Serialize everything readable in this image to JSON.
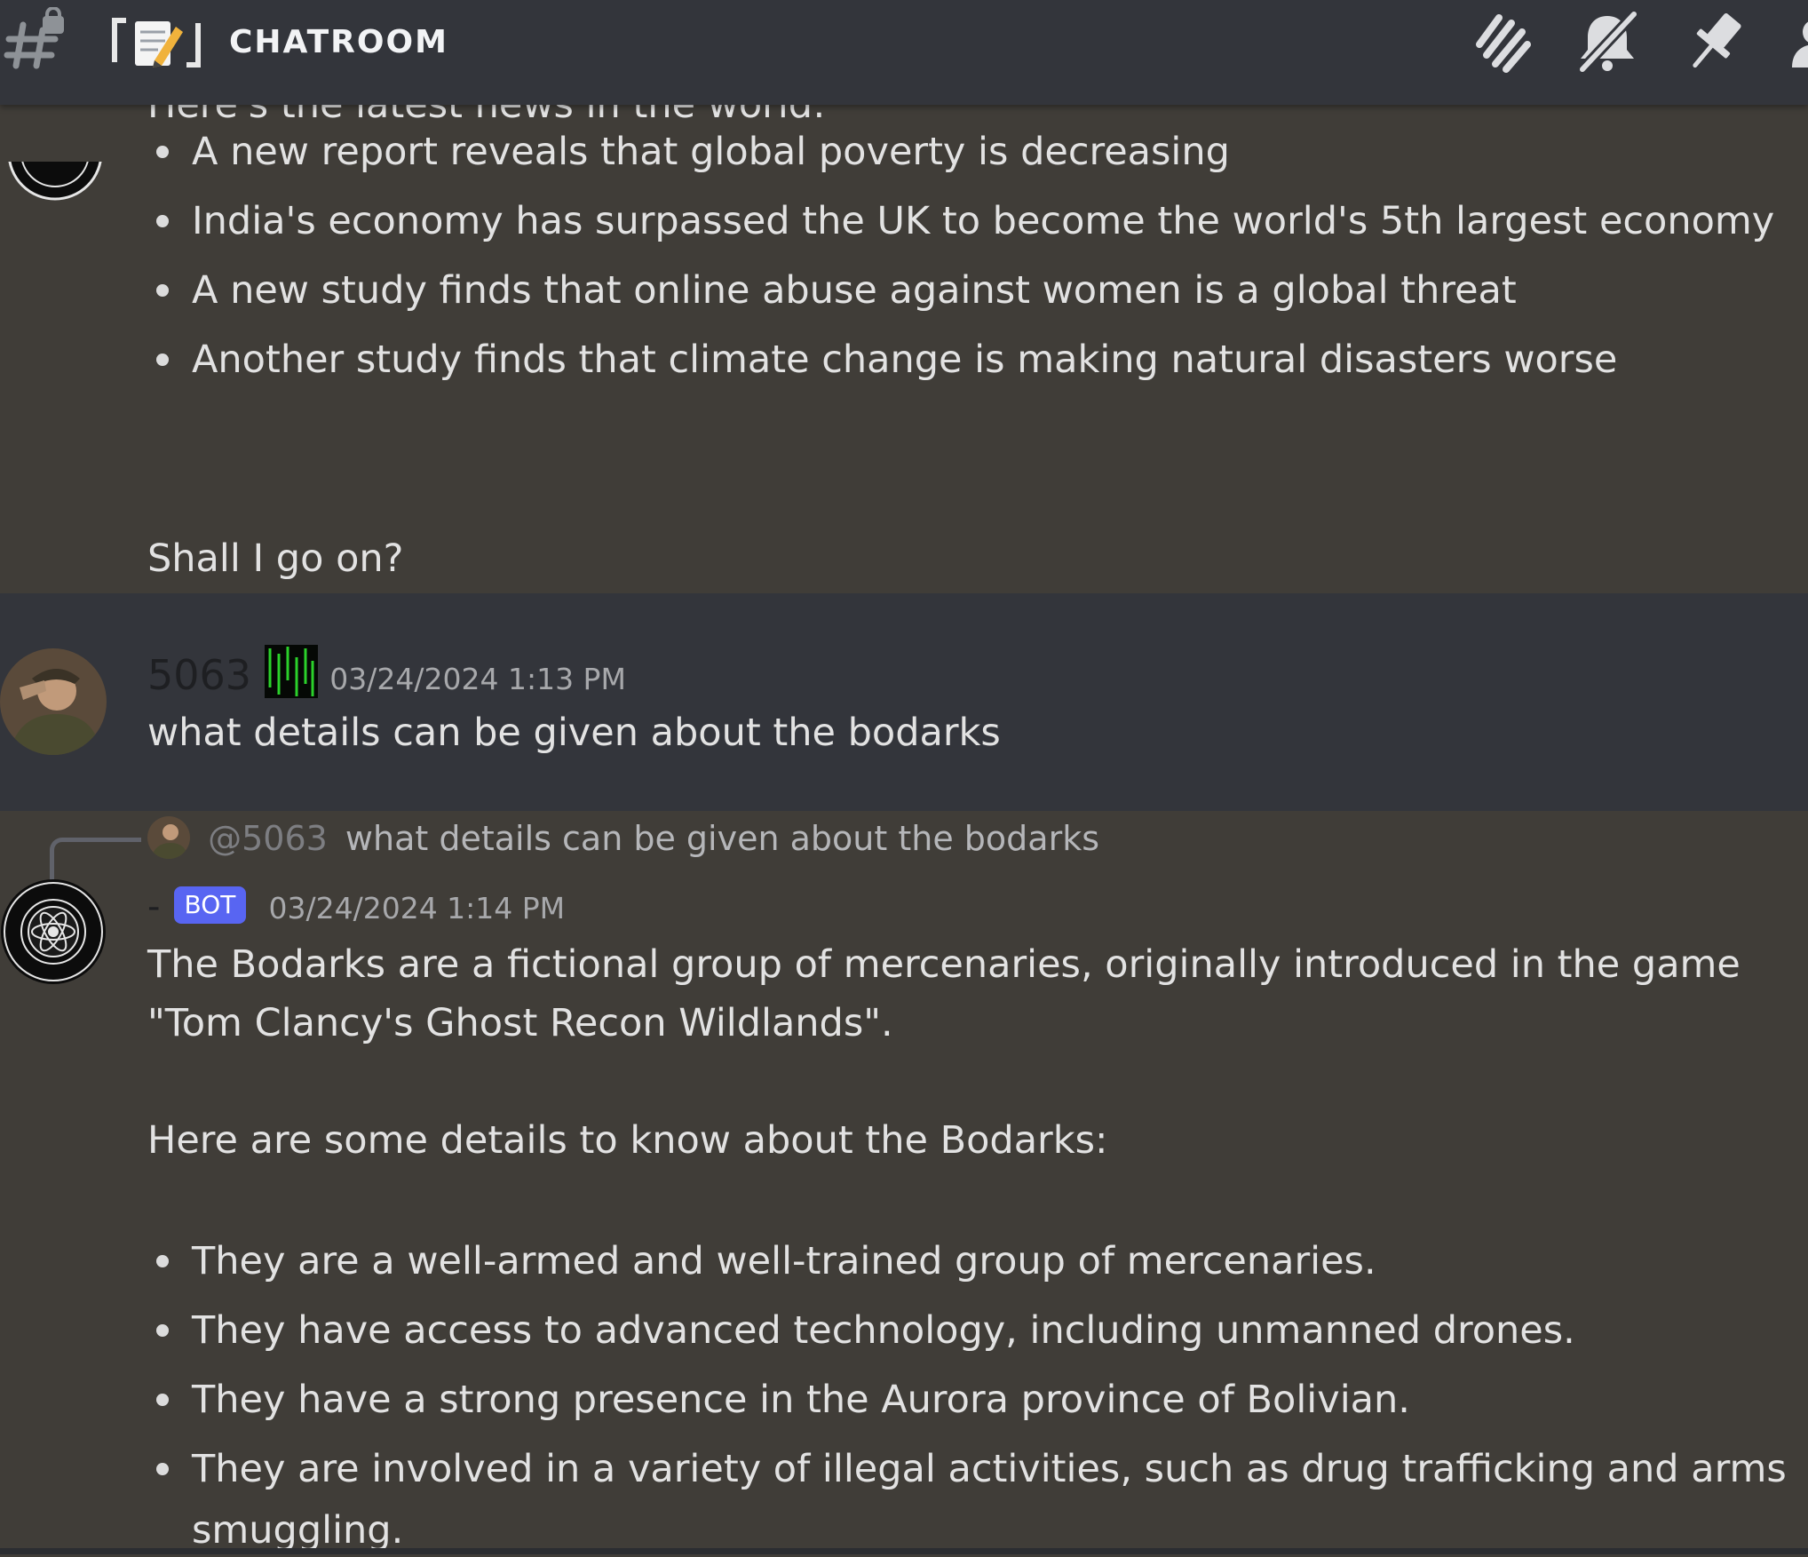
{
  "header": {
    "channel_emoji": "『📝』",
    "channel_name": "CHATROOM",
    "icons": [
      "hash-lock-icon",
      "threads-icon",
      "bell-muted-icon",
      "pin-icon",
      "members-icon"
    ]
  },
  "messages": [
    {
      "clipped_text": "Here's the latest news in the world:",
      "bullets": [
        "A new report reveals that global poverty is decreasing",
        "India's economy has surpassed the UK to become the world's 5th largest economy",
        "A new study finds that online abuse against women is a global threat",
        "Another study finds that climate change is making natural disasters worse"
      ],
      "closing": "Shall I go on?"
    },
    {
      "username": "5063",
      "timestamp": "03/24/2024 1:13 PM",
      "text": "what details can be given about the bodarks"
    },
    {
      "reply": {
        "mention": "@5063",
        "text": "what details can be given about the bodarks"
      },
      "username": "-",
      "badge": "BOT",
      "timestamp": "03/24/2024 1:14 PM",
      "intro": "The Bodarks are a fictional group of mercenaries, originally introduced in the game \"Tom Clancy's Ghost Recon Wildlands\".",
      "lead": "Here are some details to know about the Bodarks:",
      "bullets": [
        "They are a well-armed and well-trained group of mercenaries.",
        "They have access to advanced technology, including unmanned drones.",
        "They have a strong presence in the Aurora province of Bolivian.",
        "They are involved in a variety of illegal activities, such as drug trafficking and arms",
        "smuggling."
      ]
    }
  ],
  "colors": {
    "header": "#33353b",
    "chat": "#403d38",
    "highlight": "#33353b",
    "bot_badge": "#5865f2"
  }
}
